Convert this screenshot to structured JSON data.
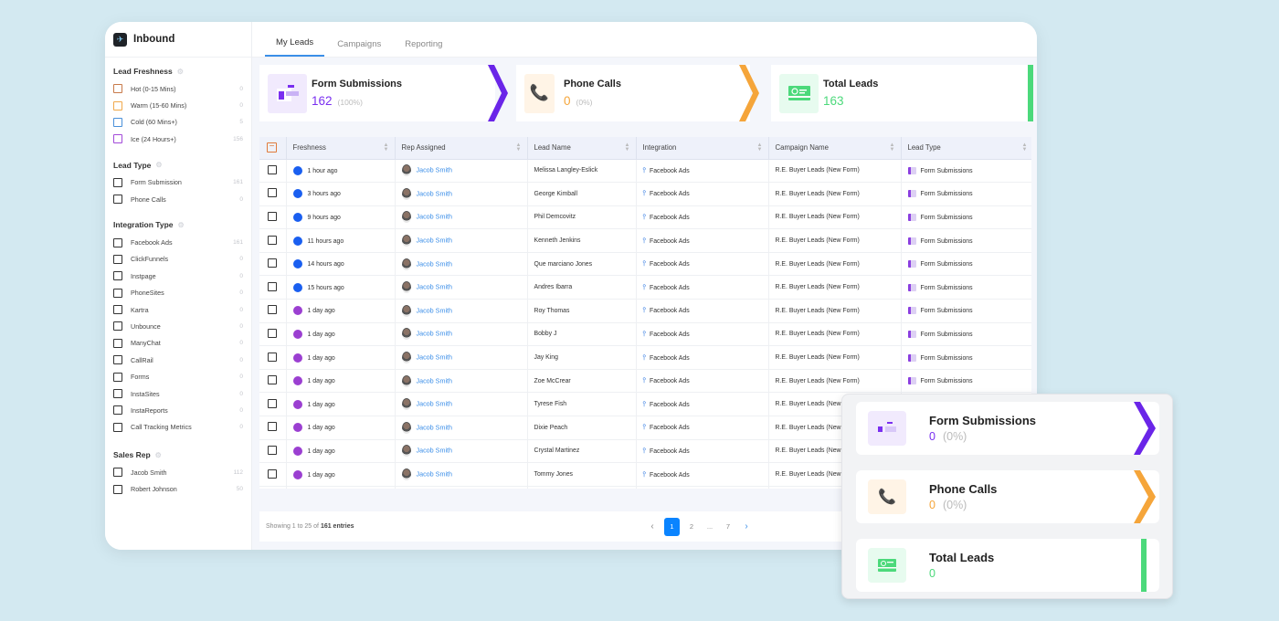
{
  "app": {
    "title": "Inbound"
  },
  "sidebar": {
    "sections": [
      {
        "title": "Lead Freshness",
        "icon": "refresh-icon",
        "items": [
          {
            "label": "Hot (0-15 Mins)",
            "count": "0",
            "color": "#c87a4a"
          },
          {
            "label": "Warm (15-60 Mins)",
            "count": "0",
            "color": "#f0a84a"
          },
          {
            "label": "Cold (60 Mins+)",
            "count": "5",
            "color": "#4a90d9"
          },
          {
            "label": "Ice (24 Hours+)",
            "count": "156",
            "color": "#a24ad9"
          }
        ]
      },
      {
        "title": "Lead Type",
        "icon": "bulb-icon",
        "items": [
          {
            "label": "Form Submission",
            "count": "161"
          },
          {
            "label": "Phone Calls",
            "count": "0"
          }
        ]
      },
      {
        "title": "Integration Type",
        "icon": "integration-icon",
        "items": [
          {
            "label": "Facebook Ads",
            "count": "161"
          },
          {
            "label": "ClickFunnels",
            "count": "0"
          },
          {
            "label": "Instpage",
            "count": "0"
          },
          {
            "label": "PhoneSites",
            "count": "0"
          },
          {
            "label": "Kartra",
            "count": "0"
          },
          {
            "label": "Unbounce",
            "count": "0"
          },
          {
            "label": "ManyChat",
            "count": "0"
          },
          {
            "label": "CallRail",
            "count": "0"
          },
          {
            "label": "Forms",
            "count": "0"
          },
          {
            "label": "InstaSites",
            "count": "0"
          },
          {
            "label": "InstaReports",
            "count": "0"
          },
          {
            "label": "Call Tracking Metrics",
            "count": "0"
          }
        ]
      },
      {
        "title": "Sales Rep",
        "icon": "building-icon",
        "items": [
          {
            "label": "Jacob Smith",
            "count": "112"
          },
          {
            "label": "Robert Johnson",
            "count": "50"
          }
        ]
      }
    ]
  },
  "tabs": [
    {
      "label": "My Leads",
      "active": true
    },
    {
      "label": "Campaigns",
      "active": false
    },
    {
      "label": "Reporting",
      "active": false
    }
  ],
  "cards": {
    "form": {
      "title": "Form Submissions",
      "value": "162",
      "pct": "(100%)",
      "color": "#7a2ff0"
    },
    "phone": {
      "title": "Phone Calls",
      "value": "0",
      "pct": "(0%)",
      "color": "#f5a53a"
    },
    "total": {
      "title": "Total Leads",
      "value": "163",
      "color": "#4cd97b"
    }
  },
  "table": {
    "headers": [
      "Freshness",
      "Rep Assigned",
      "Lead Name",
      "Integration",
      "Campaign Name",
      "Lead Type"
    ],
    "rows": [
      {
        "freshness": "1 hour ago",
        "dot": "#1a5ff0",
        "rep": "Jacob Smith",
        "lead": "Melissa Langley-Eslick",
        "integration": "Facebook Ads",
        "campaign": "R.E. Buyer Leads (New Form)",
        "type": "Form Submissions"
      },
      {
        "freshness": "3 hours ago",
        "dot": "#1a5ff0",
        "rep": "Jacob Smith",
        "lead": "George Kimball",
        "integration": "Facebook Ads",
        "campaign": "R.E. Buyer Leads (New Form)",
        "type": "Form Submissions"
      },
      {
        "freshness": "9 hours ago",
        "dot": "#1a5ff0",
        "rep": "Jacob Smith",
        "lead": "Phil Demcovitz",
        "integration": "Facebook Ads",
        "campaign": "R.E. Buyer Leads (New Form)",
        "type": "Form Submissions"
      },
      {
        "freshness": "11 hours ago",
        "dot": "#1a5ff0",
        "rep": "Jacob Smith",
        "lead": "Kenneth Jenkins",
        "integration": "Facebook Ads",
        "campaign": "R.E. Buyer Leads (New Form)",
        "type": "Form Submissions"
      },
      {
        "freshness": "14 hours ago",
        "dot": "#1a5ff0",
        "rep": "Jacob Smith",
        "lead": "Que marciano Jones",
        "integration": "Facebook Ads",
        "campaign": "R.E. Buyer Leads (New Form)",
        "type": "Form Submissions"
      },
      {
        "freshness": "15 hours ago",
        "dot": "#1a5ff0",
        "rep": "Jacob Smith",
        "lead": "Andres Ibarra",
        "integration": "Facebook Ads",
        "campaign": "R.E. Buyer Leads (New Form)",
        "type": "Form Submissions"
      },
      {
        "freshness": "1 day ago",
        "dot": "#9b3fd1",
        "rep": "Jacob Smith",
        "lead": "Roy Thomas",
        "integration": "Facebook Ads",
        "campaign": "R.E. Buyer Leads (New Form)",
        "type": "Form Submissions"
      },
      {
        "freshness": "1 day ago",
        "dot": "#9b3fd1",
        "rep": "Jacob Smith",
        "lead": "Bobby J",
        "integration": "Facebook Ads",
        "campaign": "R.E. Buyer Leads (New Form)",
        "type": "Form Submissions"
      },
      {
        "freshness": "1 day ago",
        "dot": "#9b3fd1",
        "rep": "Jacob Smith",
        "lead": "Jay King",
        "integration": "Facebook Ads",
        "campaign": "R.E. Buyer Leads (New Form)",
        "type": "Form Submissions"
      },
      {
        "freshness": "1 day ago",
        "dot": "#9b3fd1",
        "rep": "Jacob Smith",
        "lead": "Zoe McCrear",
        "integration": "Facebook Ads",
        "campaign": "R.E. Buyer Leads (New Form)",
        "type": "Form Submissions"
      },
      {
        "freshness": "1 day ago",
        "dot": "#9b3fd1",
        "rep": "Jacob Smith",
        "lead": "Tyrese Fish",
        "integration": "Facebook Ads",
        "campaign": "R.E. Buyer Leads (New Form)",
        "type": ""
      },
      {
        "freshness": "1 day ago",
        "dot": "#9b3fd1",
        "rep": "Jacob Smith",
        "lead": "Dixie Peach",
        "integration": "Facebook Ads",
        "campaign": "R.E. Buyer Leads (New Form)",
        "type": ""
      },
      {
        "freshness": "1 day ago",
        "dot": "#9b3fd1",
        "rep": "Jacob Smith",
        "lead": "Crystal Martinez",
        "integration": "Facebook Ads",
        "campaign": "R.E. Buyer Leads (New Form)",
        "type": ""
      },
      {
        "freshness": "1 day ago",
        "dot": "#9b3fd1",
        "rep": "Jacob Smith",
        "lead": "Tommy Jones",
        "integration": "Facebook Ads",
        "campaign": "R.E. Buyer Leads (New Form)",
        "type": ""
      }
    ]
  },
  "footer": {
    "showing_prefix": "Showing 1 to 25 of ",
    "showing_total": "161 entries"
  },
  "pagination": {
    "prev": "‹",
    "pages": [
      "1",
      "2",
      "...",
      "7"
    ],
    "current": "1",
    "next": "›"
  },
  "popup": {
    "form": {
      "title": "Form Submissions",
      "value": "0",
      "pct": "(0%)"
    },
    "phone": {
      "title": "Phone Calls",
      "value": "0",
      "pct": "(0%)"
    },
    "total": {
      "title": "Total Leads",
      "value": "0"
    }
  }
}
